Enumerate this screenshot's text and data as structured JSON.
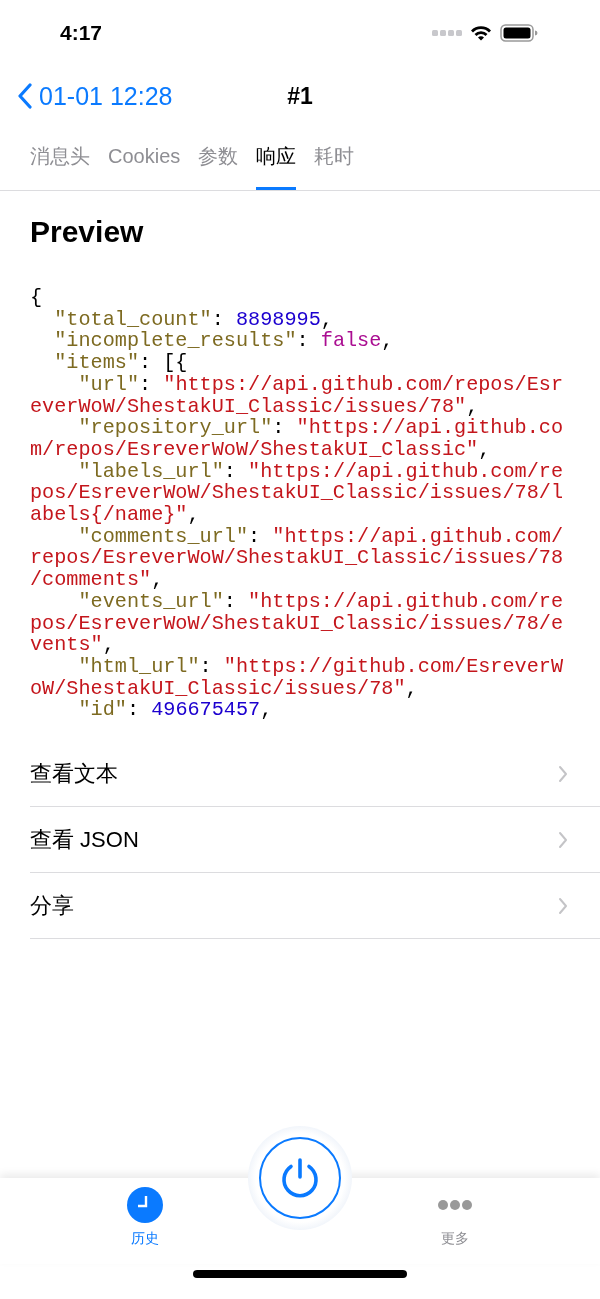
{
  "status_bar": {
    "time": "4:17"
  },
  "nav": {
    "back": "01-01 12:28",
    "title": "#1"
  },
  "tabs": [
    {
      "label": "消息头",
      "selected": false
    },
    {
      "label": "Cookies",
      "selected": false
    },
    {
      "label": "参数",
      "selected": false
    },
    {
      "label": "响应",
      "selected": true
    },
    {
      "label": "耗时",
      "selected": false
    }
  ],
  "preview": {
    "title": "Preview",
    "code_lines": [
      [
        {
          "kind": "punct",
          "text": "{"
        }
      ],
      [
        {
          "kind": "key",
          "text": "  \"total_count\""
        },
        {
          "kind": "punct",
          "text": ": "
        },
        {
          "kind": "number",
          "text": "8898995"
        },
        {
          "kind": "punct",
          "text": ","
        }
      ],
      [
        {
          "kind": "key",
          "text": "  \"incomplete_results\""
        },
        {
          "kind": "punct",
          "text": ": "
        },
        {
          "kind": "keyword",
          "text": "false"
        },
        {
          "kind": "punct",
          "text": ","
        }
      ],
      [
        {
          "kind": "key",
          "text": "  \"items\""
        },
        {
          "kind": "punct",
          "text": ": [{"
        }
      ],
      [
        {
          "kind": "key",
          "text": "    \"url\""
        },
        {
          "kind": "punct",
          "text": ": "
        },
        {
          "kind": "string",
          "text": "\"https://api.github.com/repos/Esr"
        }
      ],
      [
        {
          "kind": "string",
          "text": "everWoW/ShestakUI_Classic/issues/78\""
        },
        {
          "kind": "punct",
          "text": ","
        }
      ],
      [
        {
          "kind": "key",
          "text": "    \"repository_url\""
        },
        {
          "kind": "punct",
          "text": ": "
        },
        {
          "kind": "string",
          "text": "\"https://api.github.co"
        }
      ],
      [
        {
          "kind": "string",
          "text": "m/repos/EsreverWoW/ShestakUI_Classic\""
        },
        {
          "kind": "punct",
          "text": ","
        }
      ],
      [
        {
          "kind": "key",
          "text": "    \"labels_url\""
        },
        {
          "kind": "punct",
          "text": ": "
        },
        {
          "kind": "string",
          "text": "\"https://api.github.com/re"
        }
      ],
      [
        {
          "kind": "string",
          "text": "pos/EsreverWoW/ShestakUI_Classic/issues/78/l"
        }
      ],
      [
        {
          "kind": "string",
          "text": "abels{/name}\""
        },
        {
          "kind": "punct",
          "text": ","
        }
      ],
      [
        {
          "kind": "key",
          "text": "    \"comments_url\""
        },
        {
          "kind": "punct",
          "text": ": "
        },
        {
          "kind": "string",
          "text": "\"https://api.github.com/"
        }
      ],
      [
        {
          "kind": "string",
          "text": "repos/EsreverWoW/ShestakUI_Classic/issues/78"
        }
      ],
      [
        {
          "kind": "string",
          "text": "/comments\""
        },
        {
          "kind": "punct",
          "text": ","
        }
      ],
      [
        {
          "kind": "key",
          "text": "    \"events_url\""
        },
        {
          "kind": "punct",
          "text": ": "
        },
        {
          "kind": "string",
          "text": "\"https://api.github.com/re"
        }
      ],
      [
        {
          "kind": "string",
          "text": "pos/EsreverWoW/ShestakUI_Classic/issues/78/e"
        }
      ],
      [
        {
          "kind": "string",
          "text": "vents\""
        },
        {
          "kind": "punct",
          "text": ","
        }
      ],
      [
        {
          "kind": "key",
          "text": "    \"html_url\""
        },
        {
          "kind": "punct",
          "text": ": "
        },
        {
          "kind": "string",
          "text": "\"https://github.com/EsreverW"
        }
      ],
      [
        {
          "kind": "string",
          "text": "oW/ShestakUI_Classic/issues/78\""
        },
        {
          "kind": "punct",
          "text": ","
        }
      ],
      [
        {
          "kind": "key",
          "text": "    \"id\""
        },
        {
          "kind": "punct",
          "text": ": "
        },
        {
          "kind": "number",
          "text": "496675457"
        },
        {
          "kind": "punct",
          "text": ","
        }
      ]
    ]
  },
  "actions": [
    {
      "label": "查看文本"
    },
    {
      "label": "查看 JSON"
    },
    {
      "label": "分享"
    }
  ],
  "tab_bar": {
    "items": [
      {
        "label": "历史",
        "kind": "clock",
        "selected": true
      },
      {
        "label": "更多",
        "kind": "more",
        "selected": false
      }
    ]
  }
}
